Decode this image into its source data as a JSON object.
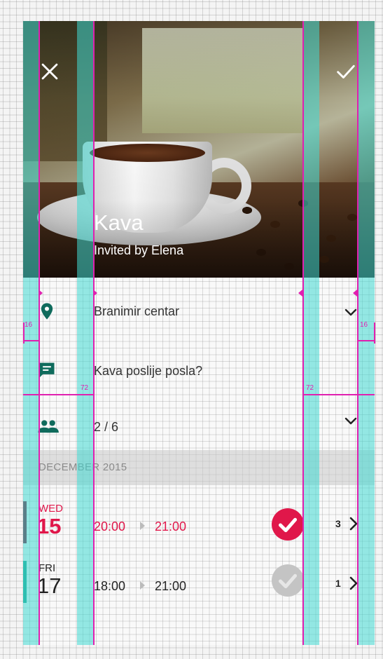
{
  "header": {
    "title": "Kava",
    "subtitle": "Invited by Elena",
    "close_icon": "close-icon",
    "confirm_icon": "check-icon"
  },
  "details": {
    "location": {
      "icon": "location-pin-icon",
      "text": "Branimir centar"
    },
    "message": {
      "icon": "message-icon",
      "text": "Kava poslije posla?"
    },
    "attendees": {
      "icon": "people-icon",
      "text": "2 / 6"
    }
  },
  "section": {
    "label": "DECEMBER 2015"
  },
  "events": [
    {
      "dow": "WED",
      "day": "15",
      "start": "20:00",
      "end": "21:00",
      "count": "3",
      "accepted": true
    },
    {
      "dow": "FRI",
      "day": "17",
      "start": "18:00",
      "end": "21:00",
      "count": "1",
      "accepted": false
    }
  ],
  "keylines": {
    "margin_left": "16",
    "margin_right": "16",
    "content_left": "72",
    "content_right": "72"
  },
  "colors": {
    "accent": "#e0174a",
    "primary": "#0f6b5c",
    "inactive": "#bdbdbd",
    "teal_bar": "#1aa08a",
    "keyline": "#e020b0",
    "keyline_fill": "#40d8d2"
  }
}
